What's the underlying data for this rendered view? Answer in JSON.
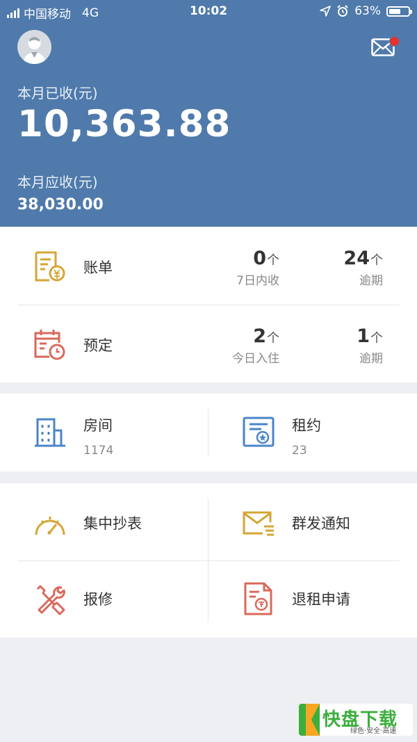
{
  "status_bar": {
    "carrier": "中国移动",
    "network": "4G",
    "time": "10:02",
    "battery": "63%",
    "battery_level": 0.63
  },
  "header": {
    "received_label": "本月已收(元)",
    "received_amount": "10,363.88",
    "receivable_label": "本月应收(元)",
    "receivable_amount": "38,030.00"
  },
  "summary": {
    "bill": {
      "title": "账单",
      "stat1": {
        "value": "0",
        "unit": "个",
        "caption": "7日内收"
      },
      "stat2": {
        "value": "24",
        "unit": "个",
        "caption": "逾期"
      }
    },
    "booking": {
      "title": "预定",
      "stat1": {
        "value": "2",
        "unit": "个",
        "caption": "今日入住"
      },
      "stat2": {
        "value": "1",
        "unit": "个",
        "caption": "逾期"
      }
    }
  },
  "assets": {
    "rooms": {
      "title": "房间",
      "count": "1174"
    },
    "leases": {
      "title": "租约",
      "count": "23"
    }
  },
  "tools": {
    "meter": "集中抄表",
    "notify": "群发通知",
    "repair": "报修",
    "checkout": "退租申请"
  },
  "watermark": {
    "title": "快盘下载",
    "tagline": "绿色·安全·高速"
  },
  "colors": {
    "header_bg": "#4f7aab",
    "gold": "#d4a635",
    "red": "#d9695b",
    "blue": "#4a85c8",
    "badge": "#e5312f"
  }
}
